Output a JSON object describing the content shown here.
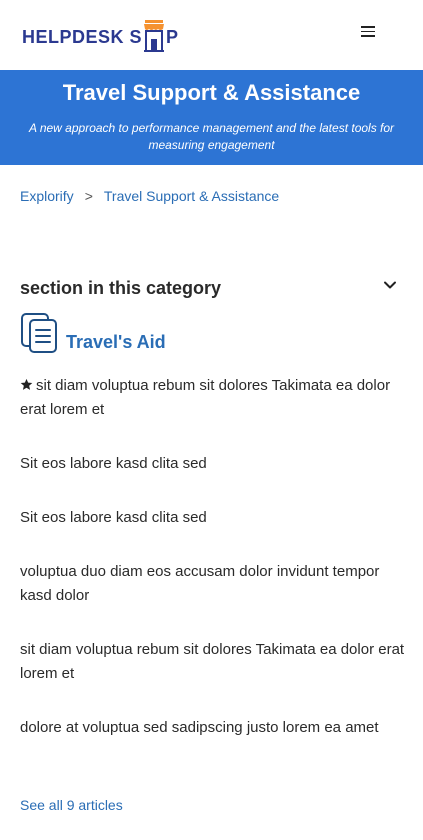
{
  "brand": {
    "logo_left": "HELPDESK S",
    "logo_right": "P"
  },
  "banner": {
    "title": "Travel Support & Assistance",
    "subtitle": "A new approach to performance management and the latest tools for measuring engagement",
    "background_color": "#2d74d4"
  },
  "breadcrumb": {
    "items": [
      "Explorify",
      "Travel Support & Assistance"
    ],
    "separator": ">"
  },
  "section": {
    "title": "section in this category",
    "toggle_icon": "chevron-down-icon"
  },
  "category": {
    "label": "Travel's Aid",
    "icon": "documents-icon"
  },
  "articles": [
    {
      "title": "sit diam voluptua rebum sit dolores Takimata ea dolor erat lorem et",
      "starred": true
    },
    {
      "title": "Sit eos labore kasd clita sed",
      "starred": false
    },
    {
      "title": "Sit eos labore kasd clita sed",
      "starred": false
    },
    {
      "title": "voluptua duo diam eos accusam dolor invidunt tempor kasd dolor",
      "starred": false
    },
    {
      "title": "sit diam voluptua rebum sit dolores Takimata ea dolor erat lorem et",
      "starred": false
    },
    {
      "title": "dolore at voluptua sed sadipscing justo lorem ea amet",
      "starred": false
    }
  ],
  "see_all": {
    "label": "See all 9 articles"
  },
  "colors": {
    "accent": "#2a6db5",
    "brand_navy": "#2b3990",
    "brand_orange": "#f5922f"
  }
}
